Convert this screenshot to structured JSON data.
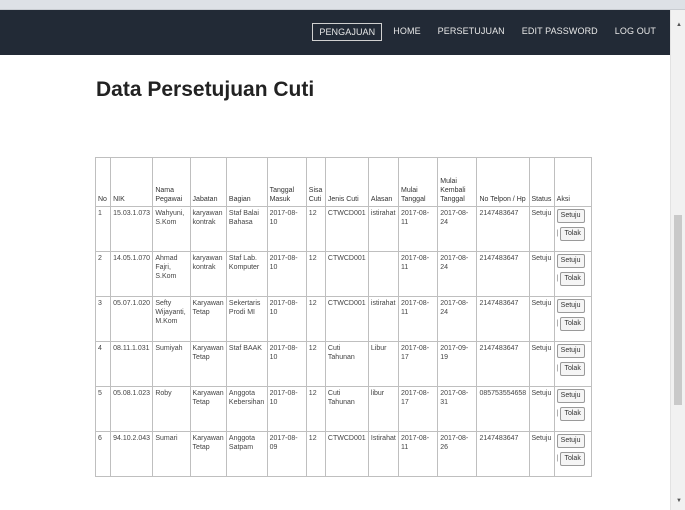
{
  "nav": [
    "PENGAJUAN",
    "HOME",
    "PERSETUJUAN",
    "EDIT PASSWORD",
    "LOG OUT"
  ],
  "page_title": "Data Persetujuan Cuti",
  "table": {
    "headers": [
      "No",
      "NIK",
      "Nama Pegawai",
      "Jabatan",
      "Bagian",
      "Tanggal Masuk",
      "Sisa Cuti",
      "Jenis Cuti",
      "Alasan",
      "Mulai Tanggal",
      "Mulai Kembali Tanggal",
      "No Telpon / Hp",
      "Status",
      "Aksi"
    ],
    "rows": [
      [
        "1",
        "15.03.1.073",
        "Wahyuni, S.Kom",
        "karyawan kontrak",
        "Staf Balai Bahasa",
        "2017-08-10",
        "12",
        "CTWCD001",
        "istirahat",
        "2017-08-11",
        "2017-08-24",
        "2147483647",
        "Setuju"
      ],
      [
        "2",
        "14.05.1.070",
        "Ahmad Fajri, S.Kom",
        "karyawan kontrak",
        "Staf Lab. Komputer",
        "2017-08-10",
        "12",
        "CTWCD001",
        "",
        "2017-08-11",
        "2017-08-24",
        "2147483647",
        "Setuju"
      ],
      [
        "3",
        "05.07.1.020",
        "Sefty Wijayanti, M.Kom",
        "Karyawan Tetap",
        "Sekertaris Prodi MI",
        "2017-08-10",
        "12",
        "CTWCD001",
        "istirahat",
        "2017-08-11",
        "2017-08-24",
        "2147483647",
        "Setuju"
      ],
      [
        "4",
        "08.11.1.031",
        "Sumiyah",
        "Karyawan Tetap",
        "Staf BAAK",
        "2017-08-10",
        "12",
        "Cuti Tahunan",
        "Libur",
        "2017-08-17",
        "2017-09-19",
        "2147483647",
        "Setuju"
      ],
      [
        "5",
        "05.08.1.023",
        "Roby",
        "Karyawan Tetap",
        "Anggota Kebersihan",
        "2017-08-10",
        "12",
        "Cuti Tahunan",
        "libur",
        "2017-08-17",
        "2017-08-31",
        "085753554658",
        "Setuju"
      ],
      [
        "6",
        "94.10.2.043",
        "Sumari",
        "Karyawan Tetap",
        "Anggota Satpam",
        "2017-08-09",
        "12",
        "CTWCD001",
        "Istirahat",
        "2017-08-11",
        "2017-08-26",
        "2147483647",
        "Setuju"
      ]
    ],
    "approve_label": "Setuju",
    "separator": "|",
    "reject_label": "Tolak"
  }
}
